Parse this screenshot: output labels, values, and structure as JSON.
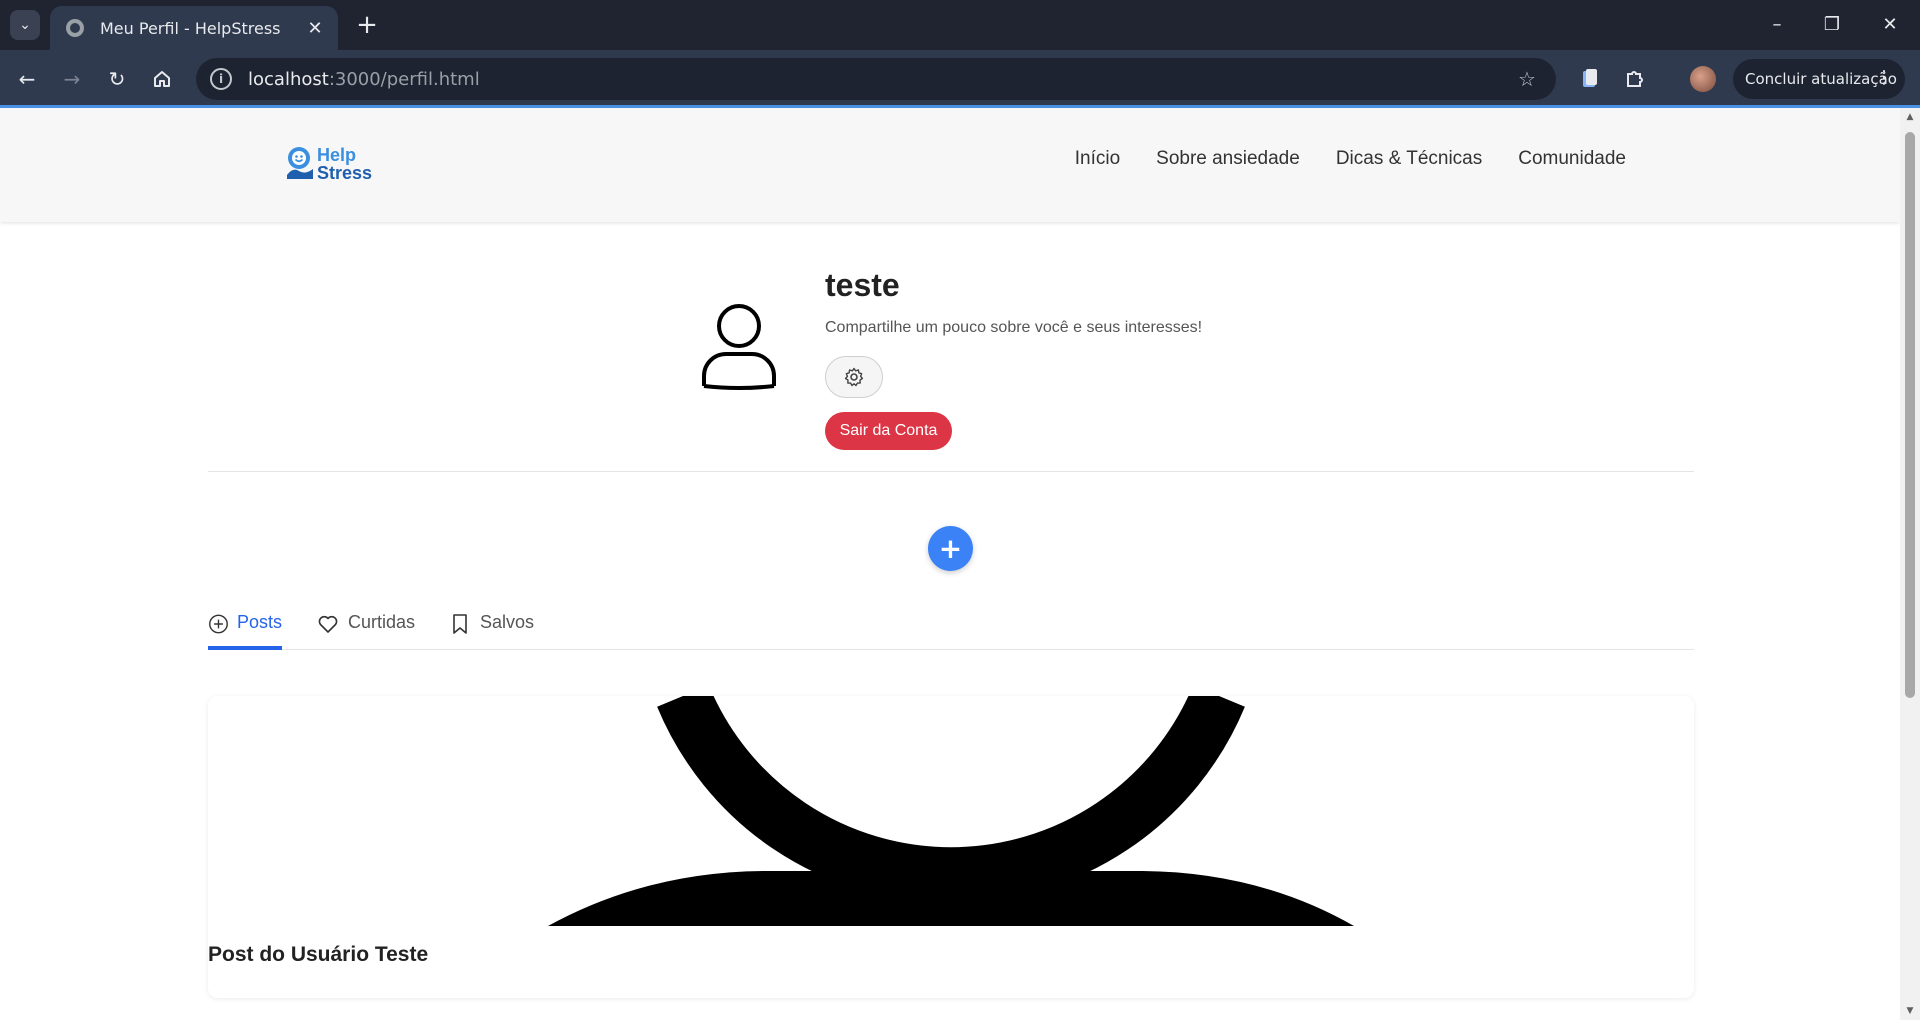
{
  "browser": {
    "tab_title": "Meu Perfil - HelpStress",
    "url_host": "localhost",
    "url_path": ":3000/perfil.html",
    "update_label": "Concluir atualização"
  },
  "site": {
    "logo_line1": "Help",
    "logo_line2": "Stress",
    "nav": [
      "Início",
      "Sobre ansiedade",
      "Dicas & Técnicas",
      "Comunidade"
    ]
  },
  "profile": {
    "name": "teste",
    "bio": "Compartilhe um pouco sobre você e seus interesses!",
    "logout_label": "Sair da Conta"
  },
  "tabs": {
    "posts": "Posts",
    "liked": "Curtidas",
    "saved": "Salvos"
  },
  "post": {
    "title": "Post do Usuário Teste"
  },
  "colors": {
    "accent": "#2563eb",
    "fab": "#3b82f6",
    "logout": "#dc3545"
  }
}
